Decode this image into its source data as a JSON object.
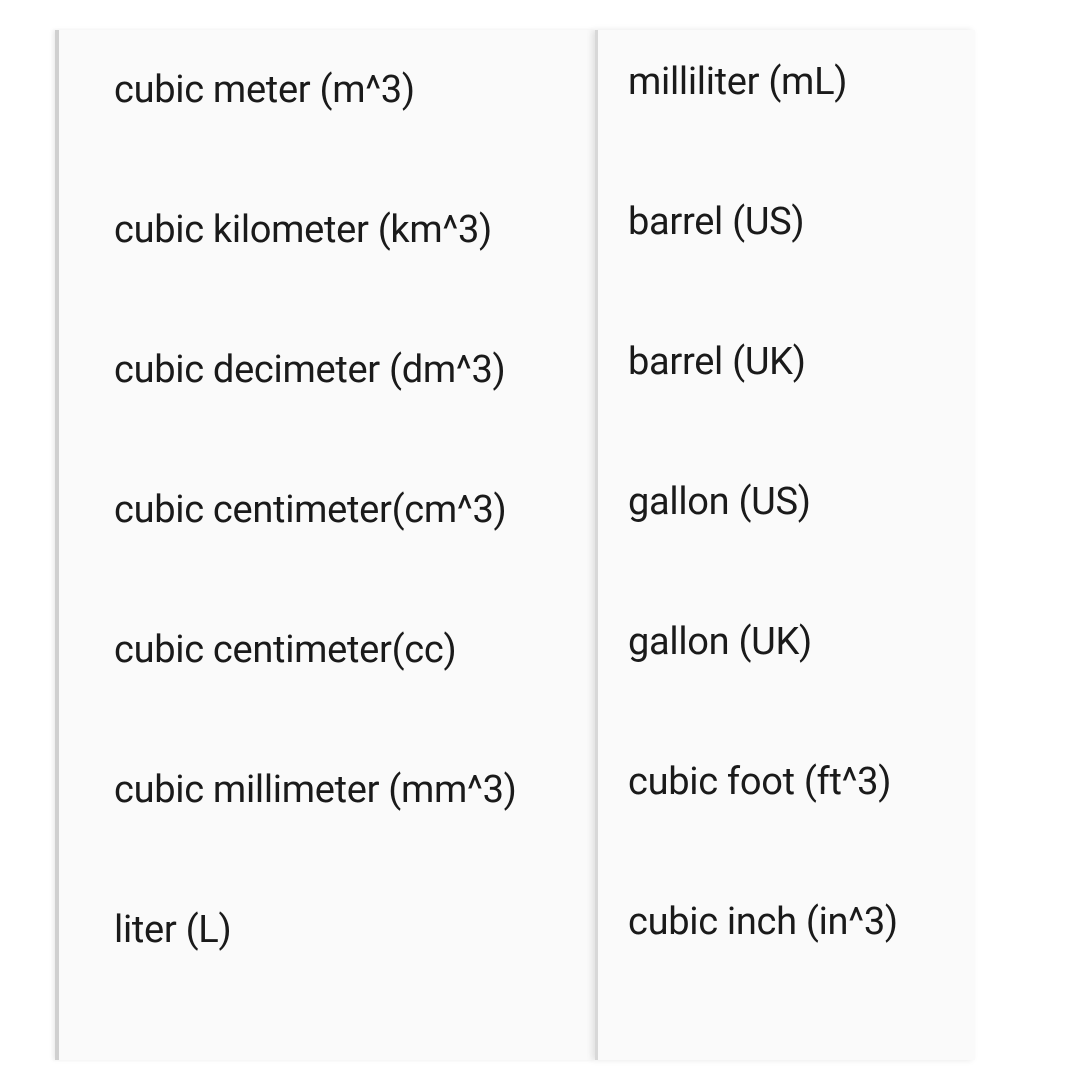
{
  "volume_units": {
    "left_column": [
      "cubic meter (m^3)",
      "cubic kilometer (km^3)",
      "cubic decimeter (dm^3)",
      "cubic centimeter(cm^3)",
      "cubic centimeter(cc)",
      "cubic millimeter (mm^3)",
      "liter (L)"
    ],
    "right_column": [
      "milliliter (mL)",
      "barrel (US)",
      "barrel (UK)",
      "gallon (US)",
      "gallon (UK)",
      "cubic foot (ft^3)",
      "cubic inch (in^3)"
    ]
  }
}
